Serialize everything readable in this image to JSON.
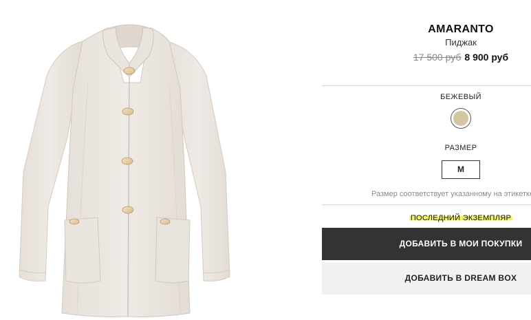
{
  "product": {
    "brand": "AMARANTO",
    "type": "Пиджак",
    "old_price": "17 500 руб",
    "new_price": "8 900 руб",
    "image_alt": "beige-jacket-photo"
  },
  "color": {
    "label": "БЕЖЕВЫЙ",
    "swatch_color": "#d4c5a3"
  },
  "size": {
    "label": "РАЗМЕР",
    "selected": "M",
    "note": "Размер соответствует указанному на этикетке"
  },
  "availability": {
    "text": "ПОСЛЕДНИЙ ЭКЗЕМПЛЯР",
    "highlight_color": "#f3f26a"
  },
  "actions": {
    "add_to_cart": "ДОБАВИТЬ В МОИ ПОКУПКИ",
    "add_to_dreambox": "ДОБАВИТЬ В DREAM BOX"
  }
}
